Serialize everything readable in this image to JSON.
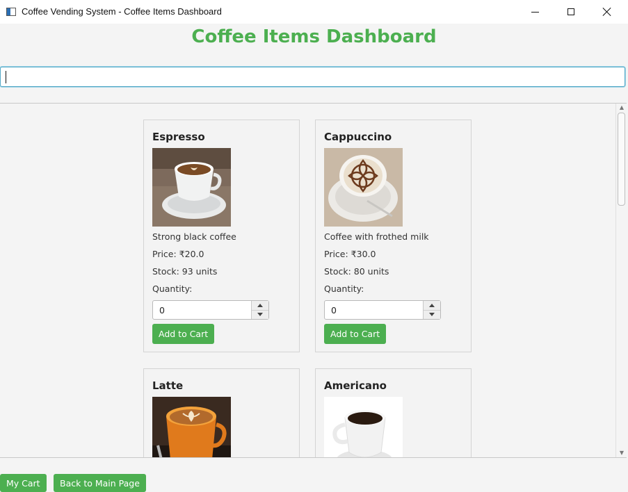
{
  "window": {
    "title": "Coffee Vending System - Coffee Items Dashboard"
  },
  "page": {
    "heading": "Coffee Items Dashboard"
  },
  "search": {
    "value": "",
    "placeholder": ""
  },
  "colors": {
    "accent": "#4caf50",
    "focus_border": "#53a8c6"
  },
  "items": [
    {
      "name": "Espresso",
      "description": "Strong black coffee",
      "price": "Price: ₹20.0",
      "stock": "Stock: 93 units",
      "quantity_label": "Quantity:",
      "quantity": "0",
      "add_label": "Add to Cart",
      "image_icon": "espresso-cup-image"
    },
    {
      "name": "Cappuccino",
      "description": "Coffee with frothed milk",
      "price": "Price: ₹30.0",
      "stock": "Stock: 80 units",
      "quantity_label": "Quantity:",
      "quantity": "0",
      "add_label": "Add to Cart",
      "image_icon": "cappuccino-cup-image"
    },
    {
      "name": "Latte",
      "image_icon": "latte-cup-image"
    },
    {
      "name": "Americano",
      "image_icon": "americano-cup-image"
    }
  ],
  "footer": {
    "cart_label": "My Cart",
    "back_label": "Back to Main Page"
  }
}
